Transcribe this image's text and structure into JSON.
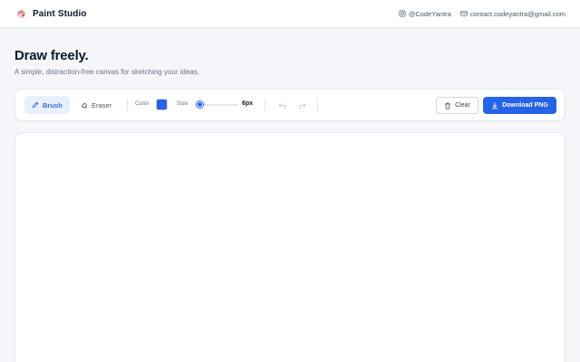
{
  "app": {
    "name": "Paint Studio",
    "logo_icon": "palette-icon",
    "accent_color": "#2563eb"
  },
  "header": {
    "social_icon": "instagram-icon",
    "social_handle": "@CodeYantra",
    "email_icon": "mail-icon",
    "email": "contact.codeyantra@gmail.com"
  },
  "hero": {
    "title": "Draw freely.",
    "subtitle": "A simple, distraction-free canvas for sketching your ideas."
  },
  "toolbar": {
    "tools": [
      {
        "label": "Brush",
        "icon": "pencil-icon",
        "active": true
      },
      {
        "label": "Eraser",
        "icon": "eraser-icon",
        "active": false
      }
    ],
    "color_label": "Color",
    "color_value": "#2563eb",
    "size_label": "Size",
    "size_value": "6px",
    "size_level": 0.05,
    "undo_icon": "undo-icon",
    "redo_icon": "redo-icon",
    "clear_label": "Clear",
    "clear_icon": "trash-icon",
    "download_label": "Download PNG",
    "download_icon": "download-icon"
  }
}
